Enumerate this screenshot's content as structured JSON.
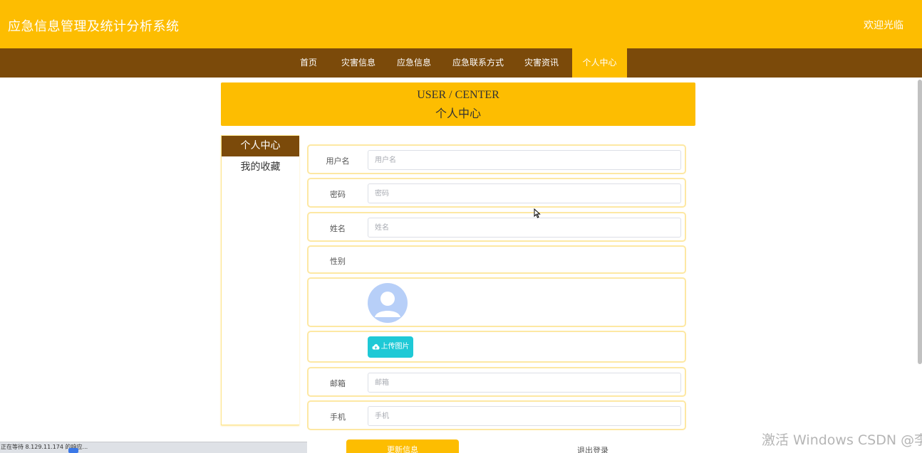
{
  "header": {
    "site_title": "应急信息管理及统计分析系统",
    "welcome": "欢迎光临"
  },
  "nav": {
    "items": [
      {
        "label": "首页"
      },
      {
        "label": "灾害信息"
      },
      {
        "label": "应急信息"
      },
      {
        "label": "应急联系方式"
      },
      {
        "label": "灾害资讯"
      },
      {
        "label": "个人中心",
        "active": true
      }
    ]
  },
  "banner": {
    "title_en": "USER / CENTER",
    "title_cn": "个人中心"
  },
  "side_menu": {
    "items": [
      {
        "label": "个人中心",
        "active": true
      },
      {
        "label": "我的收藏"
      }
    ]
  },
  "form": {
    "username": {
      "label": "用户名",
      "placeholder": "用户名",
      "value": ""
    },
    "password": {
      "label": "密码",
      "placeholder": "密码",
      "value": ""
    },
    "name": {
      "label": "姓名",
      "placeholder": "姓名",
      "value": ""
    },
    "gender": {
      "label": "性别",
      "value": ""
    },
    "avatar": {
      "icon": "user-avatar-icon"
    },
    "upload": {
      "label": "上传图片",
      "icon": "cloud-upload-icon"
    },
    "email": {
      "label": "邮箱",
      "placeholder": "邮箱",
      "value": ""
    },
    "phone": {
      "label": "手机",
      "placeholder": "手机",
      "value": ""
    }
  },
  "actions": {
    "update_label": "更新信息",
    "logout_label": "退出登录"
  },
  "statusbar": {
    "text": "正在等待 8.129.11.174 的响应..."
  },
  "watermark": {
    "text": "激活 Windows CSDN @李子a"
  },
  "colors": {
    "primary": "#fdbd01",
    "nav_bg": "#7b4a0a",
    "upload_btn": "#1ec9d6",
    "row_border": "#fde8a3"
  }
}
